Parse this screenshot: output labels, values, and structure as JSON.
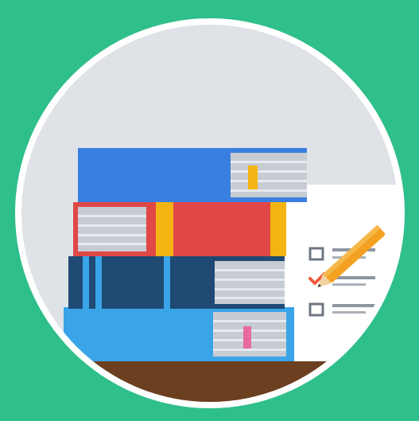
{
  "colors": {
    "background": "#2fbf8a",
    "circle_ring": "#ffffff",
    "circle_fill": "#dfe3e7",
    "shelf": "#6b3f1f",
    "book_blue": "#3a7ee0",
    "book_red": "#e04848",
    "book_navy": "#1f4a73",
    "book_lightblue": "#3aa4e8",
    "accent_yellow": "#f4b414",
    "page_grey": "#c7ccd2",
    "checklist_paper": "#ffffff",
    "pencil": "#f4a020",
    "check_mark": "#f15a3a",
    "line_grey": "#8d96a0"
  },
  "icons": {
    "main": "books-checklist-icon"
  }
}
